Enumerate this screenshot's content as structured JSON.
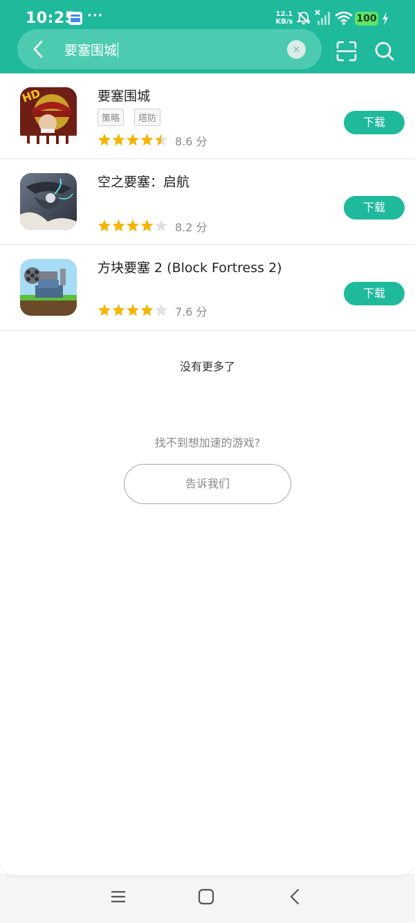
{
  "status_bar": {
    "time": "10:25",
    "more": "···",
    "net_speed_value": "12.1",
    "net_speed_unit": "KB/s",
    "battery": "100"
  },
  "search": {
    "query": "要塞围城",
    "clear": "×"
  },
  "results": [
    {
      "name": "要塞围城",
      "tags": [
        "策略",
        "塔防"
      ],
      "stars": 4.5,
      "score": "8.6 分",
      "button": "下载"
    },
    {
      "name": "空之要塞：启航",
      "tags": [],
      "stars": 4,
      "score": "8.2 分",
      "button": "下载"
    },
    {
      "name": "方块要塞 2 (Block Fortress 2)",
      "tags": [],
      "stars": 4,
      "score": "7.6 分",
      "button": "下载"
    }
  ],
  "footer": {
    "no_more": "没有更多了",
    "hint": "找不到想加速的游戏?",
    "tell_button": "告诉我们"
  },
  "colors": {
    "accent": "#1fb99c",
    "star": "#f5b400",
    "star_empty": "#e0e0e0"
  },
  "icons": {
    "back": "chevron-left-icon",
    "scan": "scan-icon",
    "search": "search-icon",
    "nav_menu": "menu-icon",
    "nav_home": "home-icon",
    "nav_back": "back-icon"
  }
}
